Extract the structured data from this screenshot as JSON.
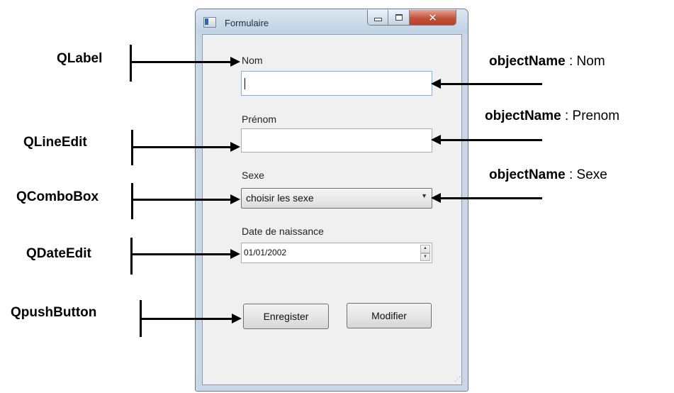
{
  "window": {
    "title": "Formulaire",
    "minimize_icon": "minimize-icon",
    "maximize_icon": "maximize-icon",
    "close_icon": "close-icon"
  },
  "form": {
    "nom_label": "Nom",
    "nom_value": "",
    "prenom_label": "Prénom",
    "prenom_value": "",
    "sexe_label": "Sexe",
    "sexe_selected": "choisir les sexe",
    "date_label": "Date de naissance",
    "date_value": "01/01/2002",
    "save_button": "Enregister",
    "modify_button": "Modifier"
  },
  "annotations": {
    "left": [
      "QLabel",
      "QLineEdit",
      "QComboBox",
      "QDateEdit",
      "QpushButton"
    ],
    "right": [
      {
        "key": "objectName",
        "sep": " : ",
        "value": "Nom"
      },
      {
        "key": "objectName",
        "sep": " : ",
        "value": "Prenom"
      },
      {
        "key": "objectName",
        "sep": " : ",
        "value": "Sexe"
      }
    ]
  }
}
